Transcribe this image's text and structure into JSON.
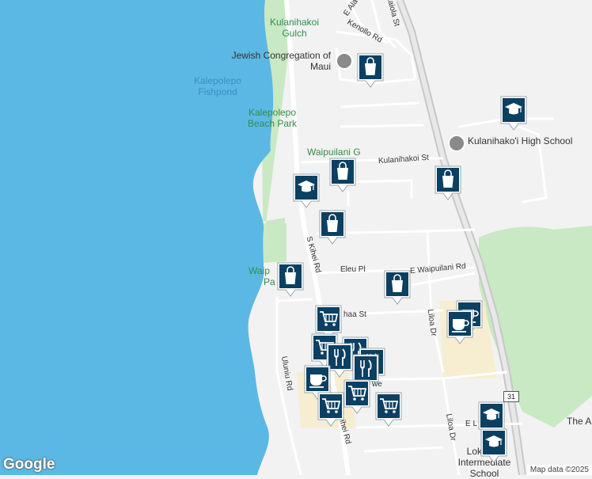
{
  "map": {
    "water_labels": [
      "Kalepolepo Fishpond"
    ],
    "park_labels": [
      "Kulanihakoi Gulch",
      "Kalepolepo Beach Park",
      "Waipuilani G",
      "Waip",
      "Pa"
    ],
    "poi_labels": [
      "Jewish Congregation of Maui",
      "Kulanihako'i High School",
      "Lokelani Intermediate School",
      "The A"
    ],
    "streets": {
      "e_alanui": "E Ala",
      "kaiola": "Kaiola St",
      "kenollo": "Kenollo Rd",
      "kulanihakoi": "Kulanihakoi St",
      "s_kihei": "S Kihei Rd",
      "s_kihei_lower": "ihei Rd",
      "eleu": "Eleu Pl",
      "e_waipuilani": "E Waipuilani Rd",
      "liloa": "Liloa Dr",
      "liloa_lower": "Liloa Dr",
      "uluniu": "Uluniu Rd",
      "ohaa": "haa St",
      "awe": "we",
      "e_l": "E L"
    },
    "route_number": "31",
    "markers": [
      {
        "type": "shopping",
        "name": "shopping-marker"
      },
      {
        "type": "school",
        "name": "school-marker"
      },
      {
        "type": "shopping",
        "name": "shopping-marker"
      },
      {
        "type": "shopping",
        "name": "shopping-marker"
      },
      {
        "type": "school",
        "name": "school-marker"
      },
      {
        "type": "shopping",
        "name": "shopping-marker"
      },
      {
        "type": "shopping",
        "name": "shopping-marker"
      },
      {
        "type": "shopping",
        "name": "shopping-marker"
      },
      {
        "type": "grocery",
        "name": "grocery-marker"
      },
      {
        "type": "cafe",
        "name": "cafe-marker"
      },
      {
        "type": "cafe",
        "name": "cafe-marker"
      },
      {
        "type": "grocery",
        "name": "grocery-marker"
      },
      {
        "type": "restaurant",
        "name": "restaurant-marker"
      },
      {
        "type": "restaurant",
        "name": "restaurant-marker"
      },
      {
        "type": "restaurant",
        "name": "restaurant-marker"
      },
      {
        "type": "restaurant",
        "name": "restaurant-marker"
      },
      {
        "type": "cafe",
        "name": "cafe-marker"
      },
      {
        "type": "grocery",
        "name": "grocery-marker"
      },
      {
        "type": "grocery",
        "name": "grocery-marker"
      },
      {
        "type": "grocery",
        "name": "grocery-marker"
      },
      {
        "type": "school",
        "name": "school-marker"
      },
      {
        "type": "school",
        "name": "school-marker"
      }
    ],
    "colors": {
      "water": "#5bb8e4",
      "land": "#f2f2f2",
      "park": "#c9e8c4",
      "commercial": "#f7edd0",
      "road": "#ffffff",
      "highway": "#c8c8c8",
      "marker": "#0b4062"
    }
  },
  "footer": {
    "logo": "Google",
    "attribution": "Map data ©2025"
  }
}
